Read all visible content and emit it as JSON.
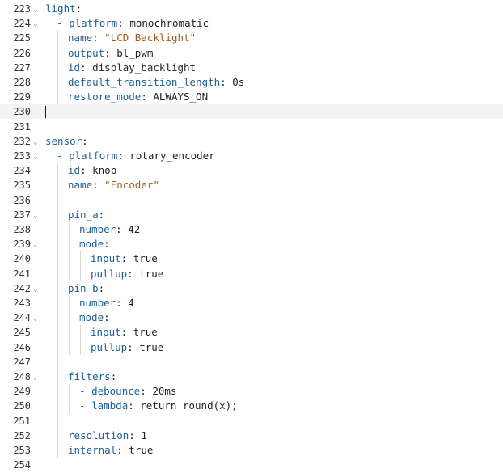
{
  "lines": [
    {
      "n": "223",
      "fold": true,
      "indent": 0,
      "tokens": [
        {
          "c": "k",
          "t": "light"
        },
        {
          "c": "p",
          "t": ":"
        }
      ]
    },
    {
      "n": "224",
      "fold": true,
      "indent": 1,
      "tokens": [
        {
          "c": "dash",
          "t": "- "
        },
        {
          "c": "k",
          "t": "platform"
        },
        {
          "c": "p",
          "t": ": "
        },
        {
          "c": "v",
          "t": "monochromatic"
        }
      ]
    },
    {
      "n": "225",
      "fold": false,
      "indent": 2,
      "tokens": [
        {
          "c": "k",
          "t": "name"
        },
        {
          "c": "p",
          "t": ": "
        },
        {
          "c": "s",
          "t": "\"LCD Backlight\""
        }
      ]
    },
    {
      "n": "226",
      "fold": false,
      "indent": 2,
      "tokens": [
        {
          "c": "k",
          "t": "output"
        },
        {
          "c": "p",
          "t": ": "
        },
        {
          "c": "v",
          "t": "bl_pwm"
        }
      ]
    },
    {
      "n": "227",
      "fold": false,
      "indent": 2,
      "tokens": [
        {
          "c": "k",
          "t": "id"
        },
        {
          "c": "p",
          "t": ": "
        },
        {
          "c": "v",
          "t": "display_backlight"
        }
      ]
    },
    {
      "n": "228",
      "fold": false,
      "indent": 2,
      "tokens": [
        {
          "c": "k",
          "t": "default_transition_length"
        },
        {
          "c": "p",
          "t": ": "
        },
        {
          "c": "v",
          "t": "0s"
        }
      ]
    },
    {
      "n": "229",
      "fold": false,
      "indent": 2,
      "tokens": [
        {
          "c": "k",
          "t": "restore_mode"
        },
        {
          "c": "p",
          "t": ": "
        },
        {
          "c": "v",
          "t": "ALWAYS_ON"
        }
      ]
    },
    {
      "n": "230",
      "fold": false,
      "indent": 0,
      "current": true,
      "tokens": []
    },
    {
      "n": "231",
      "fold": false,
      "indent": 0,
      "tokens": []
    },
    {
      "n": "232",
      "fold": true,
      "indent": 0,
      "tokens": [
        {
          "c": "k",
          "t": "sensor"
        },
        {
          "c": "p",
          "t": ":"
        }
      ]
    },
    {
      "n": "233",
      "fold": true,
      "indent": 1,
      "tokens": [
        {
          "c": "dash",
          "t": "- "
        },
        {
          "c": "k",
          "t": "platform"
        },
        {
          "c": "p",
          "t": ": "
        },
        {
          "c": "v",
          "t": "rotary_encoder"
        }
      ]
    },
    {
      "n": "234",
      "fold": false,
      "indent": 2,
      "tokens": [
        {
          "c": "k",
          "t": "id"
        },
        {
          "c": "p",
          "t": ": "
        },
        {
          "c": "v",
          "t": "knob"
        }
      ]
    },
    {
      "n": "235",
      "fold": false,
      "indent": 2,
      "tokens": [
        {
          "c": "k",
          "t": "name"
        },
        {
          "c": "p",
          "t": ": "
        },
        {
          "c": "s",
          "t": "\"Encoder\""
        }
      ]
    },
    {
      "n": "236",
      "fold": false,
      "indent": 0,
      "tokens": []
    },
    {
      "n": "237",
      "fold": true,
      "indent": 2,
      "tokens": [
        {
          "c": "k",
          "t": "pin_a"
        },
        {
          "c": "p",
          "t": ":"
        }
      ]
    },
    {
      "n": "238",
      "fold": false,
      "indent": 3,
      "tokens": [
        {
          "c": "k",
          "t": "number"
        },
        {
          "c": "p",
          "t": ": "
        },
        {
          "c": "v",
          "t": "42"
        }
      ]
    },
    {
      "n": "239",
      "fold": true,
      "indent": 3,
      "tokens": [
        {
          "c": "k",
          "t": "mode"
        },
        {
          "c": "p",
          "t": ":"
        }
      ]
    },
    {
      "n": "240",
      "fold": false,
      "indent": 4,
      "tokens": [
        {
          "c": "k",
          "t": "input"
        },
        {
          "c": "p",
          "t": ": "
        },
        {
          "c": "v",
          "t": "true"
        }
      ]
    },
    {
      "n": "241",
      "fold": false,
      "indent": 4,
      "tokens": [
        {
          "c": "k",
          "t": "pullup"
        },
        {
          "c": "p",
          "t": ": "
        },
        {
          "c": "v",
          "t": "true"
        }
      ]
    },
    {
      "n": "242",
      "fold": true,
      "indent": 2,
      "tokens": [
        {
          "c": "k",
          "t": "pin_b"
        },
        {
          "c": "p",
          "t": ":"
        }
      ]
    },
    {
      "n": "243",
      "fold": false,
      "indent": 3,
      "tokens": [
        {
          "c": "k",
          "t": "number"
        },
        {
          "c": "p",
          "t": ": "
        },
        {
          "c": "v",
          "t": "4"
        }
      ]
    },
    {
      "n": "244",
      "fold": true,
      "indent": 3,
      "tokens": [
        {
          "c": "k",
          "t": "mode"
        },
        {
          "c": "p",
          "t": ":"
        }
      ]
    },
    {
      "n": "245",
      "fold": false,
      "indent": 4,
      "tokens": [
        {
          "c": "k",
          "t": "input"
        },
        {
          "c": "p",
          "t": ": "
        },
        {
          "c": "v",
          "t": "true"
        }
      ]
    },
    {
      "n": "246",
      "fold": false,
      "indent": 4,
      "tokens": [
        {
          "c": "k",
          "t": "pullup"
        },
        {
          "c": "p",
          "t": ": "
        },
        {
          "c": "v",
          "t": "true"
        }
      ]
    },
    {
      "n": "247",
      "fold": false,
      "indent": 0,
      "tokens": []
    },
    {
      "n": "248",
      "fold": true,
      "indent": 2,
      "tokens": [
        {
          "c": "k",
          "t": "filters"
        },
        {
          "c": "p",
          "t": ":"
        }
      ]
    },
    {
      "n": "249",
      "fold": false,
      "indent": 3,
      "tokens": [
        {
          "c": "dash",
          "t": "- "
        },
        {
          "c": "k",
          "t": "debounce"
        },
        {
          "c": "p",
          "t": ": "
        },
        {
          "c": "v",
          "t": "20ms"
        }
      ]
    },
    {
      "n": "250",
      "fold": false,
      "indent": 3,
      "tokens": [
        {
          "c": "dash",
          "t": "- "
        },
        {
          "c": "k",
          "t": "lambda"
        },
        {
          "c": "p",
          "t": ": "
        },
        {
          "c": "v",
          "t": "return round(x);"
        }
      ]
    },
    {
      "n": "251",
      "fold": false,
      "indent": 0,
      "tokens": []
    },
    {
      "n": "252",
      "fold": false,
      "indent": 2,
      "tokens": [
        {
          "c": "k",
          "t": "resolution"
        },
        {
          "c": "p",
          "t": ": "
        },
        {
          "c": "v",
          "t": "1"
        }
      ]
    },
    {
      "n": "253",
      "fold": false,
      "indent": 2,
      "tokens": [
        {
          "c": "k",
          "t": "internal"
        },
        {
          "c": "p",
          "t": ": "
        },
        {
          "c": "v",
          "t": "true"
        }
      ]
    },
    {
      "n": "254",
      "fold": false,
      "indent": 0,
      "tokens": []
    }
  ],
  "icons": {
    "fold": "chevron-down-icon"
  },
  "colors": {
    "key": "#1d5f99",
    "string": "#a35b18",
    "text": "#222222",
    "current_line": "#f3f3f3",
    "indent_guide": "#d8d8d8"
  }
}
